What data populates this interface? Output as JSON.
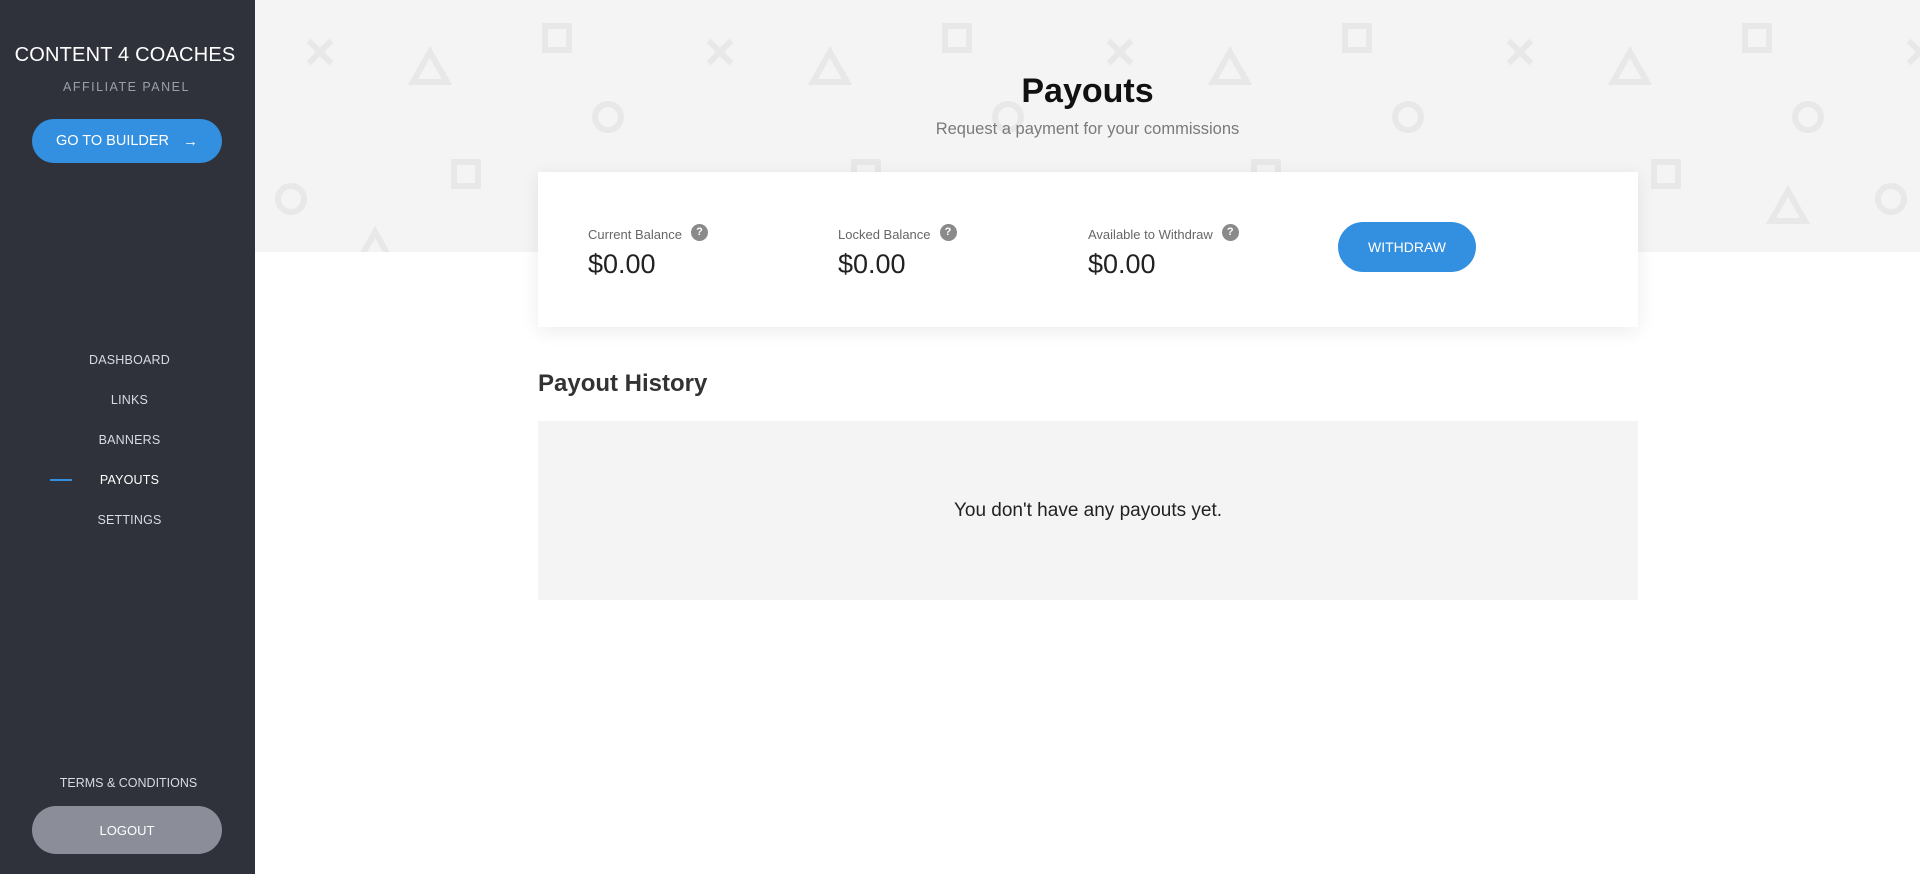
{
  "sidebar": {
    "brand_title": "CONTENT 4 COACHES",
    "brand_subtitle": "AFFILIATE PANEL",
    "builder_button": "GO TO BUILDER",
    "builder_icon": "arrow-right-icon",
    "nav": [
      {
        "label": "DASHBOARD",
        "active": false
      },
      {
        "label": "LINKS",
        "active": false
      },
      {
        "label": "BANNERS",
        "active": false
      },
      {
        "label": "PAYOUTS",
        "active": true
      },
      {
        "label": "SETTINGS",
        "active": false
      }
    ],
    "terms_link": "TERMS & CONDITIONS",
    "logout_button": "LOGOUT"
  },
  "header": {
    "title": "Payouts",
    "subtitle": "Request a payment for your commissions"
  },
  "balances": [
    {
      "label": "Current Balance",
      "value": "$0.00",
      "help": "?"
    },
    {
      "label": "Locked Balance",
      "value": "$0.00",
      "help": "?"
    },
    {
      "label": "Available to Withdraw",
      "value": "$0.00",
      "help": "?"
    }
  ],
  "withdraw_button": "WITHDRAW",
  "history": {
    "title": "Payout History",
    "empty_message": "You don't have any payouts yet."
  },
  "colors": {
    "sidebar_bg": "#2f323b",
    "accent": "#3390e0",
    "logout_bg": "#8b8e99",
    "hero_bg": "#f4f4f4"
  }
}
